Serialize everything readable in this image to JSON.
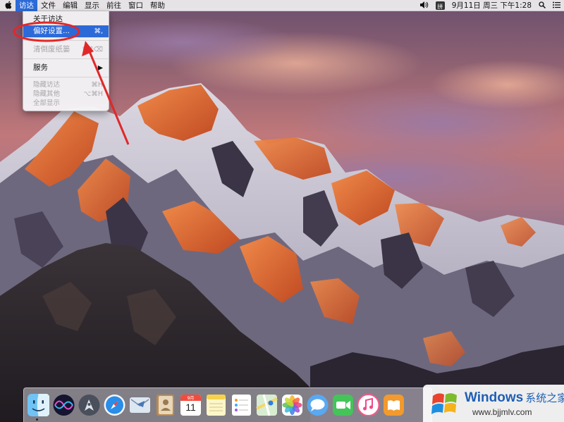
{
  "menubar": {
    "apple_icon": "apple-logo-icon",
    "items": [
      "访达",
      "文件",
      "编辑",
      "显示",
      "前往",
      "窗口",
      "帮助"
    ],
    "active_item": "访达",
    "status": {
      "volume_icon": "volume-icon",
      "ime_label": "拼",
      "clock": "9月11日 周三 下午1:28",
      "search_icon": "spotlight-search-icon",
      "list_icon": "notification-center-icon"
    }
  },
  "dropdown": {
    "items": [
      {
        "label": "关于访达",
        "shortcut": "",
        "state": "normal"
      },
      {
        "label": "偏好设置...",
        "shortcut": "⌘,",
        "state": "highlighted"
      },
      {
        "label": "清倒废纸篓",
        "shortcut": "⇧⌘⌫",
        "state": "disabled"
      },
      {
        "label": "服务",
        "shortcut": "▶",
        "state": "normal"
      },
      {
        "label": "隐藏访达",
        "shortcut": "⌘H",
        "state": "disabled"
      },
      {
        "label": "隐藏其他",
        "shortcut": "⌥⌘H",
        "state": "disabled"
      },
      {
        "label": "全部显示",
        "shortcut": "",
        "state": "disabled"
      }
    ]
  },
  "annotation": {
    "color": "#e0282a",
    "shape": "red ellipse around 偏好设置 with arrow"
  },
  "dock": {
    "icons": [
      "finder-icon",
      "siri-icon",
      "launchpad-icon",
      "safari-icon",
      "mail-icon",
      "contacts-icon",
      "calendar-icon",
      "notes-icon",
      "reminders-icon",
      "maps-icon",
      "photos-icon",
      "messages-icon",
      "facetime-icon",
      "itunes-icon",
      "ibooks-icon"
    ],
    "calendar_month": "9月",
    "calendar_day": "11"
  },
  "watermark": {
    "title": "Windows",
    "title_cn": "系统之家",
    "url": "www.bjjmlv.com"
  },
  "colors": {
    "highlight": "#2c6ad8",
    "menubar_bg": "#eeecee",
    "watermark_blue": "#1e5fb4"
  }
}
